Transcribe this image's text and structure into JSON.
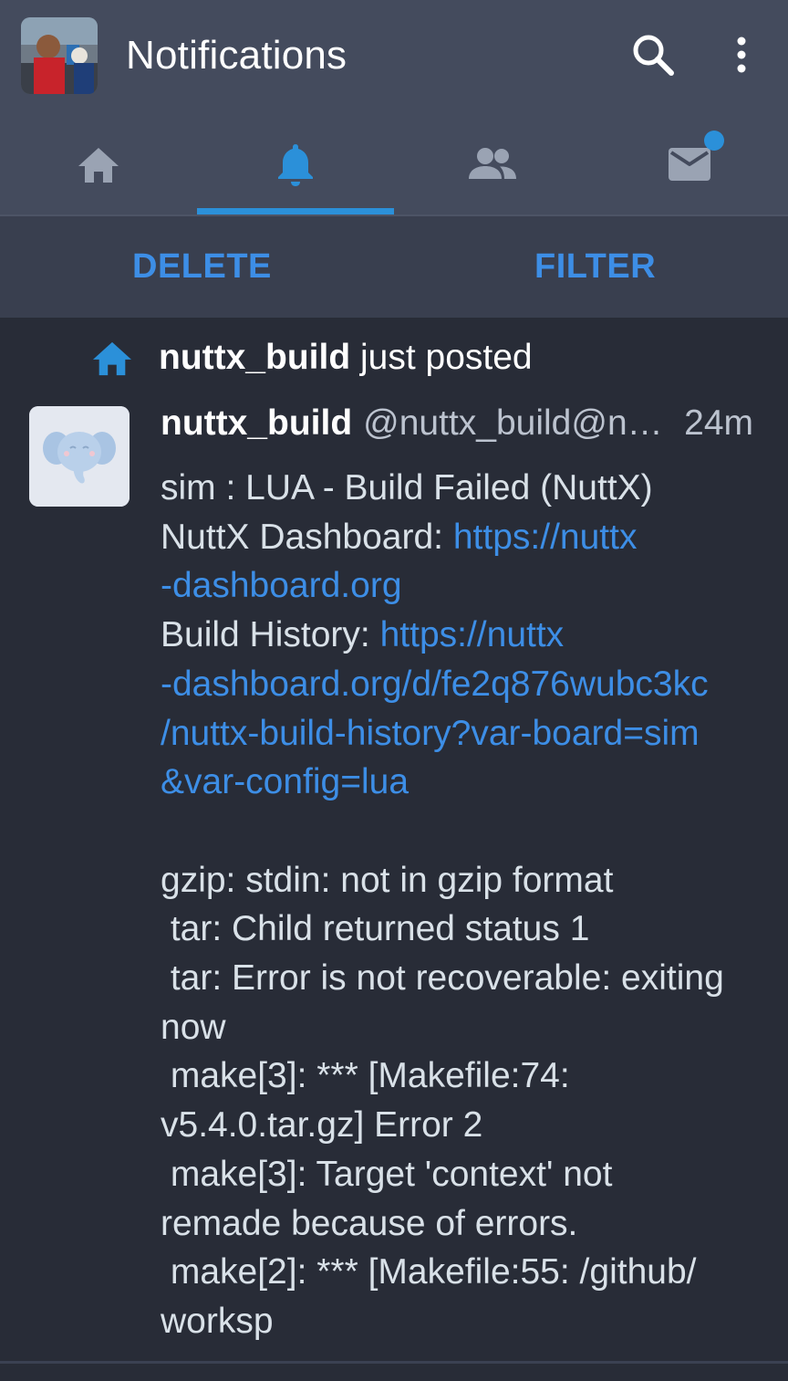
{
  "header": {
    "title": "Notifications",
    "avatar_icon": "user-avatar",
    "search_icon": "search-icon",
    "more_icon": "more-vert-icon"
  },
  "tabs": [
    {
      "name": "home",
      "icon": "home-icon",
      "active": false
    },
    {
      "name": "notifications",
      "icon": "bell-icon",
      "active": true
    },
    {
      "name": "local",
      "icon": "people-icon",
      "active": false
    },
    {
      "name": "direct",
      "icon": "mail-icon",
      "active": false,
      "has_unread": true
    }
  ],
  "actions": {
    "delete_label": "DELETE",
    "filter_label": "FILTER"
  },
  "notification": {
    "type_icon": "home-icon",
    "actor": "nuttx_build",
    "verb": " just posted",
    "post": {
      "display_name": "nuttx_build",
      "acct": "@nuttx_build@nu…",
      "time": "24m",
      "avatar_icon": "elephant-icon",
      "lines": {
        "l1": "sim : LUA - Build Failed (NuttX)",
        "l2_text": "NuttX Dashboard: ",
        "l2_link": "https://nuttx",
        "l3_link": "-dashboard.org",
        "l4_text": "Build History: ",
        "l4_link": "https://nuttx",
        "l5_link": "-dashboard.org/d/fe2q876wubc3kc",
        "l6_link": "/nuttx-build-history?var-board=sim",
        "l7_link": "&var-config=lua",
        "l9": "gzip: stdin: not in gzip format",
        "l10": " tar: Child returned status 1",
        "l11": " tar: Error is not recoverable: exiting",
        "l12": "now",
        "l13": " make[3]: *** [Makefile:74:",
        "l14": "v5.4.0.tar.gz] Error 2",
        "l15": " make[3]: Target 'context' not",
        "l16": "remade because of errors.",
        "l17": " make[2]: *** [Makefile:55: /github/",
        "l18": "worksp"
      }
    }
  },
  "colors": {
    "accent": "#2b90d9",
    "link": "#3d8ee6",
    "background": "#282c37",
    "header_bg": "#444b5d"
  }
}
